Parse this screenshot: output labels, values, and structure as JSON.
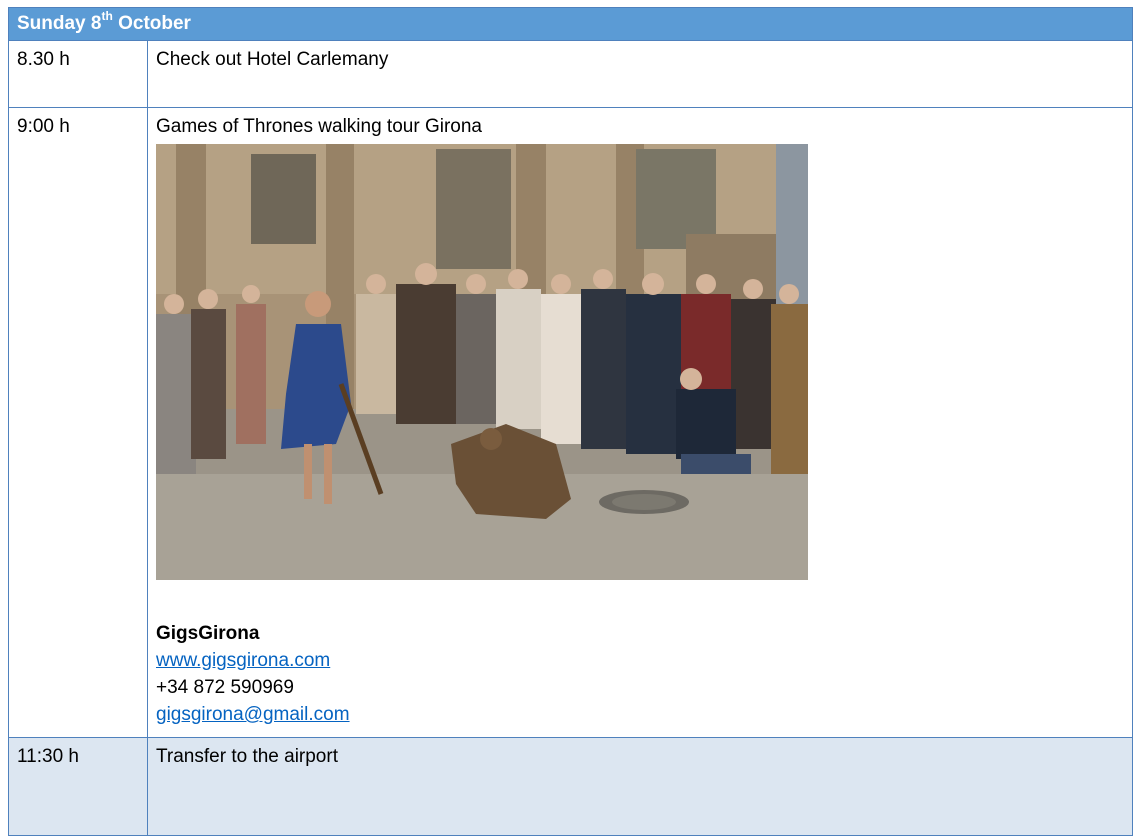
{
  "header": {
    "day": "Sunday 8",
    "sup": "th",
    "month": "October"
  },
  "rows": [
    {
      "time": "8.30 h",
      "text": "Check out Hotel Carlemany"
    },
    {
      "time": "9:00 h",
      "text": "Games of Thrones walking tour Girona",
      "contact": {
        "name": "GigsGirona",
        "website": "www.gigsgirona.com",
        "phone": "+34 872 590969",
        "email": "gigsgirona@gmail.com"
      }
    },
    {
      "time": "11:30 h",
      "text": "Transfer to the airport"
    }
  ],
  "colors": {
    "header_bg": "#5b9bd5",
    "border": "#4f81bd",
    "alt_row_bg": "#dce6f1",
    "link": "#0563c1"
  }
}
